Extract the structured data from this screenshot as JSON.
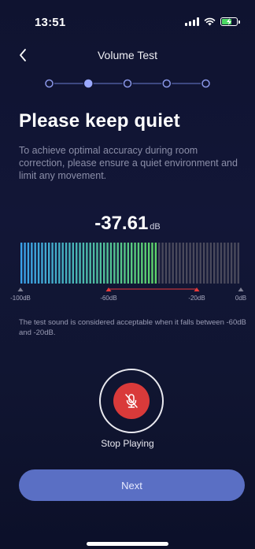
{
  "status_bar": {
    "time": "13:51",
    "icons": [
      "signal-icon",
      "wifi-icon",
      "battery-charging-icon"
    ]
  },
  "nav": {
    "back_icon": "chevron-left-icon",
    "title": "Volume Test"
  },
  "steps": {
    "total": 5,
    "current": 2
  },
  "content": {
    "title": "Please keep quiet",
    "description": "To achieve optimal accuracy during room correction, please ensure a quiet environment and limit any movement."
  },
  "reading": {
    "value": "-37.61",
    "unit": "dB"
  },
  "meter": {
    "min_db": -100,
    "max_db": 0,
    "current_db": -37.61,
    "acceptable_range_db": [
      -60,
      -20
    ],
    "ticks": [
      "-100dB",
      "-60dB",
      "-20dB",
      "0dB"
    ],
    "colors": {
      "low": "#3aa0e8",
      "high": "#5fd36a",
      "inactive": "#4a4a5c",
      "range_marker": "#e83b3b"
    }
  },
  "note": "The test sound is considered acceptable when it falls between -60dB and -20dB.",
  "mic_button": {
    "icon": "microphone-off-icon",
    "label": "Stop Playing",
    "color": "#d93a3a"
  },
  "next_button": {
    "label": "Next",
    "color": "#5a6fc4"
  }
}
